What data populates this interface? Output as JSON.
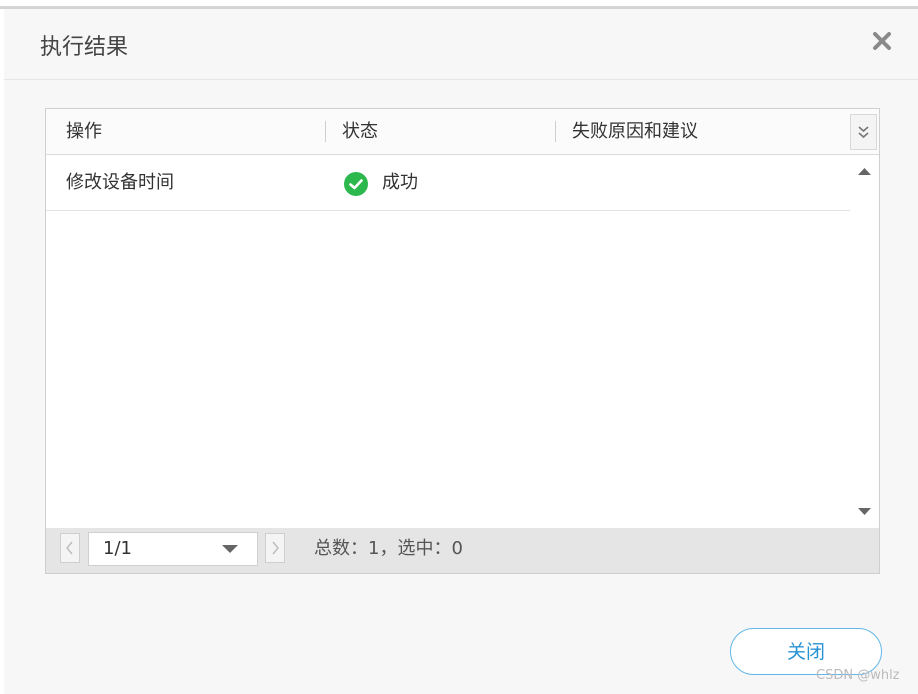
{
  "dialog": {
    "title": "执行结果",
    "close_icon": "close-icon",
    "close_button_label": "关闭"
  },
  "table": {
    "columns": [
      "操作",
      "状态",
      "失败原因和建议"
    ],
    "rows": [
      {
        "operation": "修改设备时间",
        "status": "成功",
        "status_icon": "check-circle-icon",
        "reason": ""
      }
    ],
    "status_color": "#2db84d"
  },
  "pager": {
    "page": "1/1",
    "summary": "总数：1，选中：0"
  },
  "accent_color": "#2a93d5",
  "watermark": "CSDN @whlz"
}
